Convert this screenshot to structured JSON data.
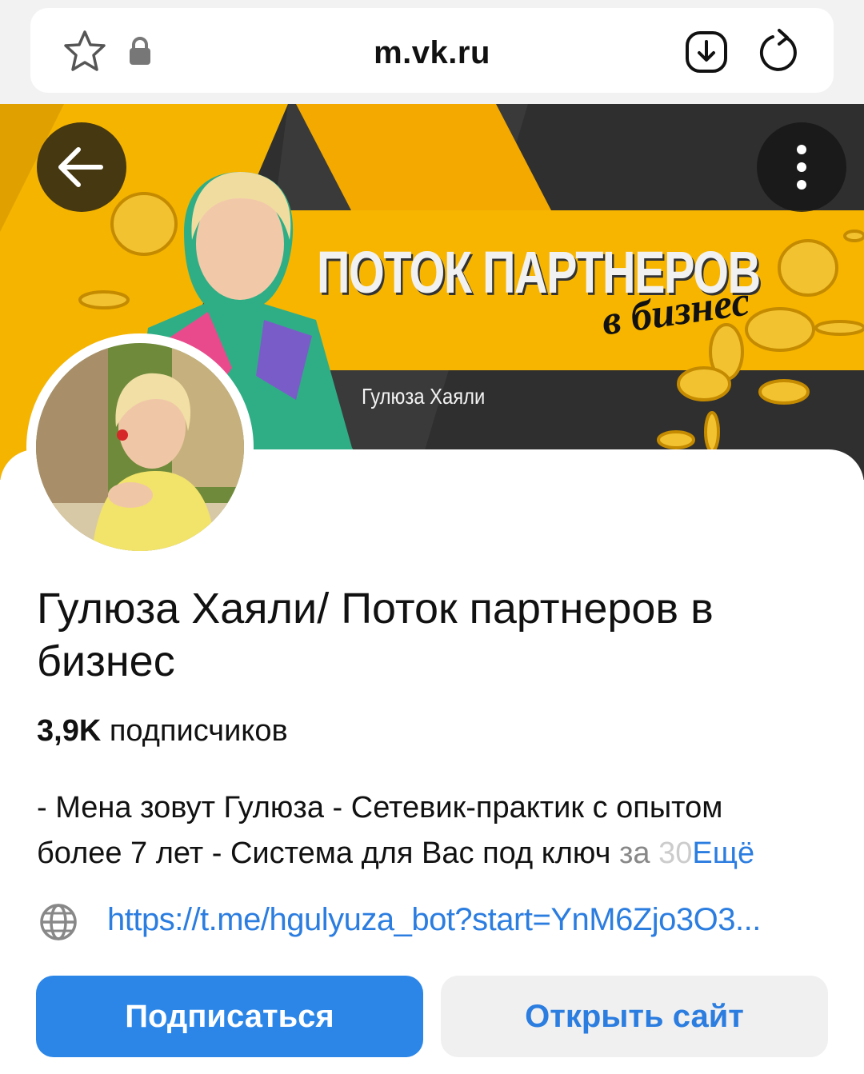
{
  "browser": {
    "url": "m.vk.ru",
    "icons": [
      "star-icon",
      "lock-icon",
      "download-icon",
      "reload-icon"
    ]
  },
  "cover": {
    "title": "ПОТОК ПАРТНЕРОВ",
    "subtitle": "в бизнес",
    "author": "Гулюза Хаяли",
    "colors": {
      "yellow": "#f5b400",
      "dark": "#2b2b2b"
    },
    "buttons": [
      "back-arrow-icon",
      "more-vertical-icon"
    ]
  },
  "profile": {
    "name": "Гулюза Хаяли/ Поток партнеров в бизнес",
    "subscribers_count": "3,9K",
    "subscribers_label": "подписчиков",
    "description_line1": "- Мена зовут Гулюза - Сетевик-практик с опытом",
    "description_line2_main": "более 7 лет - Система для Вас под ключ",
    "description_line2_fade": " за ",
    "description_line2_fade2": "30",
    "more_label": "Ещё",
    "link": "https://t.me/hgulyuza_bot?start=YnM6Zjo3O3..."
  },
  "actions": {
    "subscribe": "Подписаться",
    "open_site": "Открыть сайт"
  },
  "colors": {
    "accent": "#2b86e8",
    "link": "#2b7de0"
  }
}
